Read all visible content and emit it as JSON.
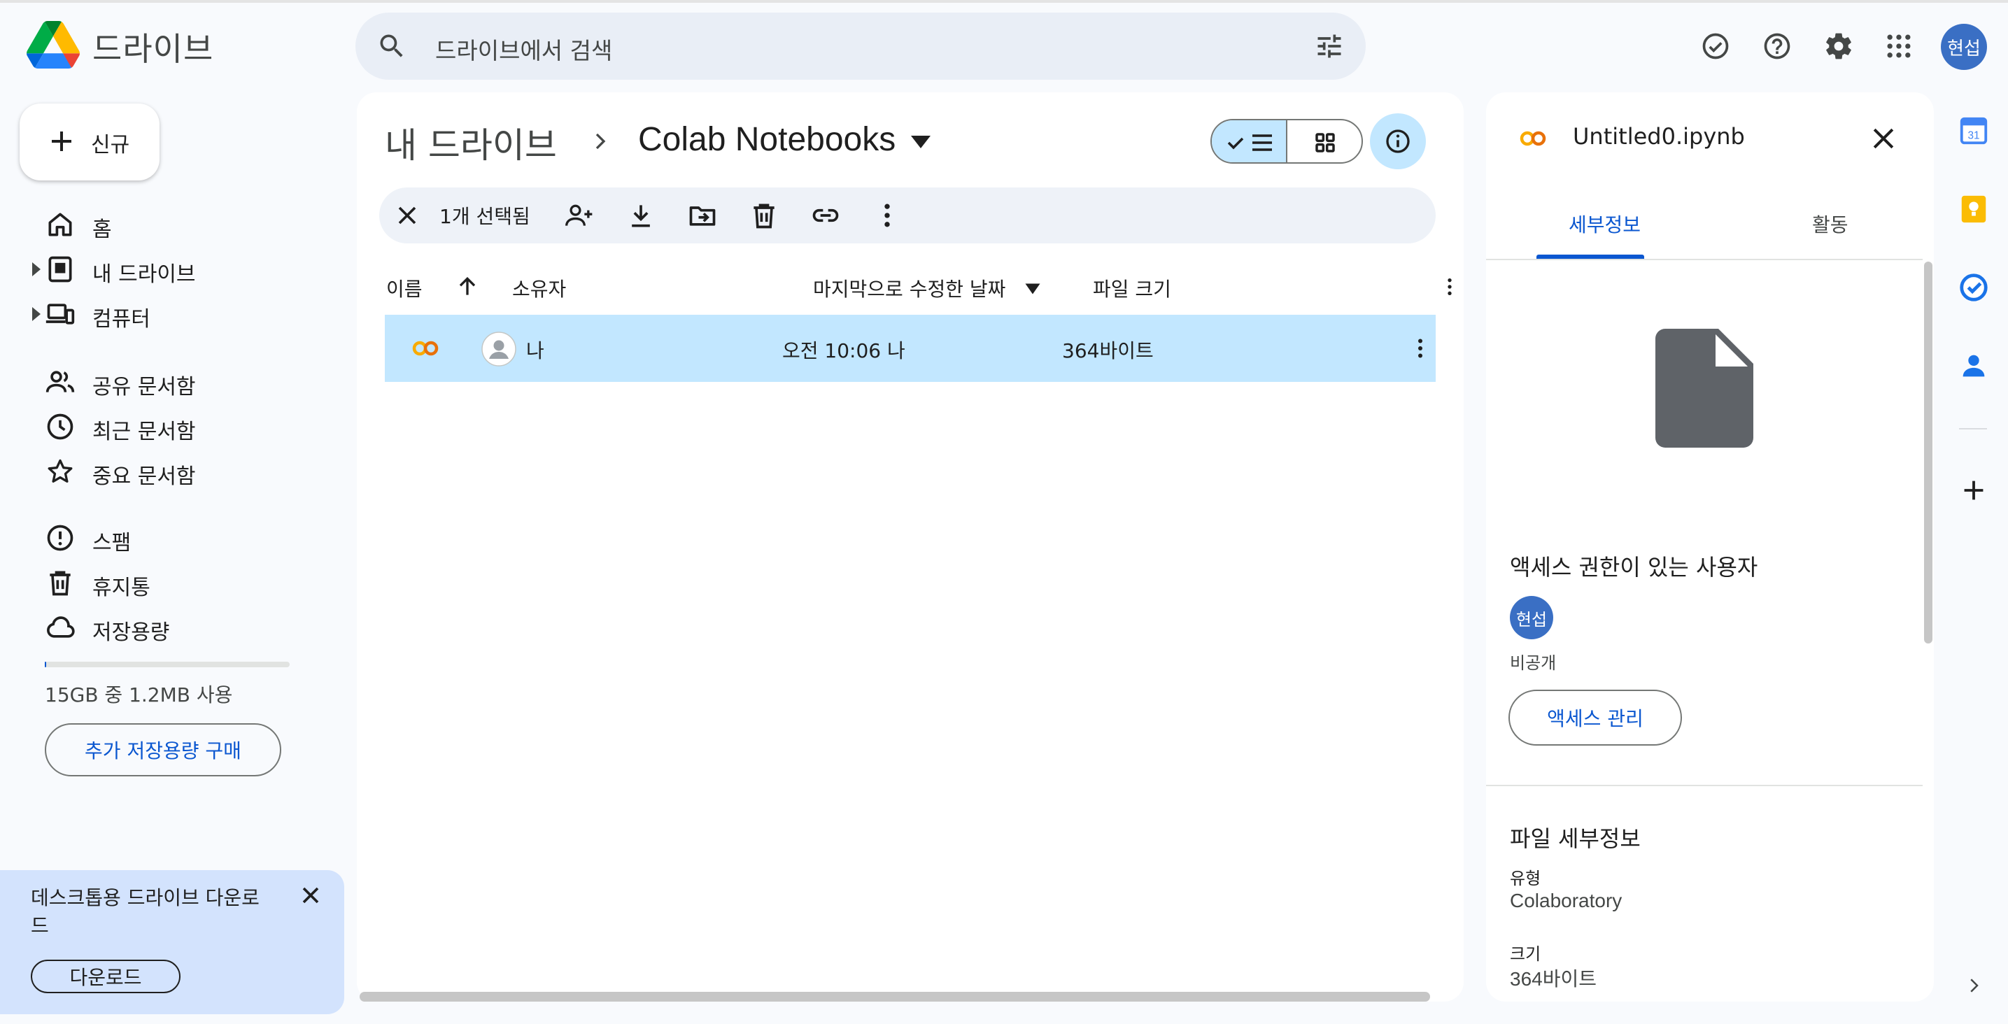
{
  "app": {
    "name": "드라이브"
  },
  "header": {
    "search_placeholder": "드라이브에서 검색",
    "avatar_initials": "현섭"
  },
  "sidebar": {
    "new_label": "신규",
    "items": [
      {
        "label": "홈",
        "icon": "home-icon"
      },
      {
        "label": "내 드라이브",
        "icon": "my-drive-icon"
      },
      {
        "label": "컴퓨터",
        "icon": "computers-icon"
      },
      {
        "label": "공유 문서함",
        "icon": "shared-icon"
      },
      {
        "label": "최근 문서함",
        "icon": "clock-icon"
      },
      {
        "label": "중요 문서함",
        "icon": "star-icon"
      },
      {
        "label": "스팸",
        "icon": "spam-icon"
      },
      {
        "label": "휴지통",
        "icon": "trash-icon"
      },
      {
        "label": "저장용량",
        "icon": "cloud-icon"
      }
    ],
    "storage_text": "15GB 중 1.2MB 사용",
    "buy_storage_label": "추가 저장용량 구매",
    "promo_text": "데스크톱용 드라이브 다운로드",
    "promo_button": "다운로드"
  },
  "main": {
    "breadcrumb_root": "내 드라이브",
    "breadcrumb_current": "Colab Notebooks",
    "selection_text": "1개 선택됨",
    "columns": [
      "이름",
      "소유자",
      "마지막으로 수정한 날짜",
      "파일 크기"
    ],
    "files": [
      {
        "owner": "나",
        "modified": "오전 10:06 나",
        "size": "364바이트"
      }
    ]
  },
  "details": {
    "file_name": "Untitled0.ipynb",
    "tabs": [
      "세부정보",
      "활동"
    ],
    "access_heading": "액세스 권한이 있는 사용자",
    "access_avatar": "현섭",
    "access_status": "비공개",
    "manage_access_label": "액세스 관리",
    "file_details_heading": "파일 세부정보",
    "type_label": "유형",
    "type_value": "Colaboratory",
    "size_label": "크기",
    "size_value": "364바이트"
  },
  "colors": {
    "accent": "#0b57d0",
    "selection": "#c2e7ff",
    "avatar": "#3a6fc4",
    "colab_orange": "#f9ab00"
  }
}
